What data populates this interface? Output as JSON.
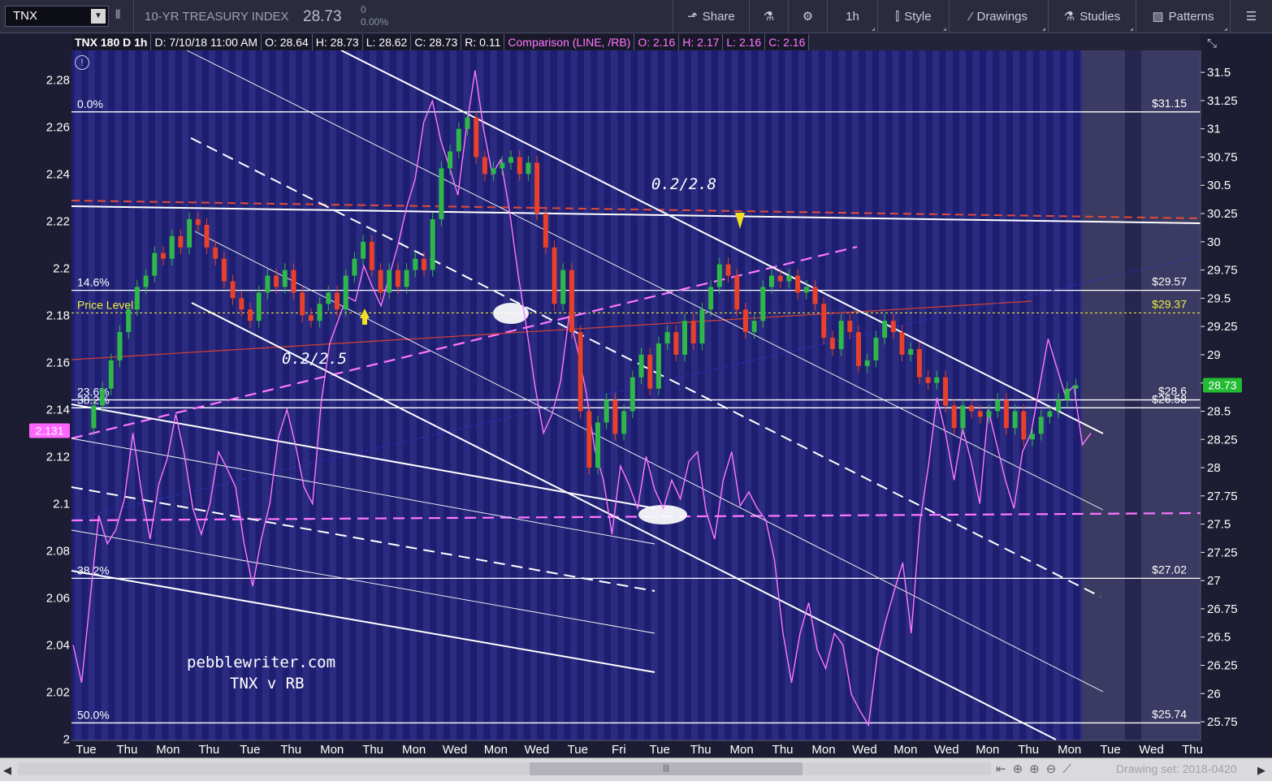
{
  "toolbar": {
    "symbol": "TNX",
    "description": "10-YR TREASURY INDEX",
    "last": "28.73",
    "change_abs": "0",
    "change_pct": "0.00%",
    "share": "Share",
    "interval": "1h",
    "style": "Style",
    "drawings": "Drawings",
    "studies": "Studies",
    "patterns": "Patterns"
  },
  "infobar": {
    "main": "TNX 180 D 1h",
    "date": "D: 7/10/18 11:00 AM",
    "open": "O: 28.64",
    "high": "H: 28.73",
    "low": "L: 28.62",
    "close": "C: 28.73",
    "range": "R: 0.11",
    "comparison": "Comparison (LINE, /RB)",
    "cmp_open": "O: 2.16",
    "cmp_high": "H: 2.17",
    "cmp_low": "L: 2.16",
    "cmp_close": "C: 2.16"
  },
  "bottombar": {
    "drawing_set": "Drawing set: 2018-0420"
  },
  "chart_data": {
    "type": "line",
    "title": "",
    "left_axis": {
      "ticks": [
        "2.28",
        "2.26",
        "2.24",
        "2.22",
        "2.2",
        "2.18",
        "2.16",
        "2.14",
        "2.12",
        "2.1",
        "2.08",
        "2.06",
        "2.04",
        "2.02",
        "2"
      ],
      "range": [
        1.9995,
        2.2925
      ],
      "current_label": "2.131"
    },
    "right_axis": {
      "ticks": [
        "31.5",
        "31.25",
        "31",
        "30.75",
        "30.5",
        "30.25",
        "30",
        "29.75",
        "29.5",
        "29.25",
        "29",
        "28.75",
        "28.5",
        "28.25",
        "28",
        "27.75",
        "27.5",
        "27.25",
        "27",
        "26.75",
        "26.5",
        "26.25",
        "26",
        "25.75"
      ],
      "range": [
        25.585,
        31.695
      ],
      "current_label": "28.73"
    },
    "x_ticks": [
      "Tue",
      "Thu",
      "Mon",
      "Thu",
      "Tue",
      "Thu",
      "Mon",
      "Thu",
      "Mon",
      "Wed",
      "Mon",
      "Wed",
      "Tue",
      "Fri",
      "Tue",
      "Thu",
      "Mon",
      "Thu",
      "Mon",
      "Wed",
      "Mon",
      "Wed",
      "Mon",
      "Thu",
      "Mon",
      "Tue",
      "Wed",
      "Thu"
    ],
    "fib_levels": [
      {
        "label": "0.0%",
        "value": "$31.15",
        "y": 31.15
      },
      {
        "label": "14.6%",
        "value": "$29.57",
        "y": 29.57
      },
      {
        "label": "23.6%",
        "value": "$28.6",
        "y": 28.6
      },
      {
        "label": "38.2%",
        "value": "$26.58",
        "y": 28.53
      },
      {
        "label": "38.2%",
        "value": "$27.02",
        "y": 27.02
      },
      {
        "label": "50.0%",
        "value": "$25.74",
        "y": 25.74
      }
    ],
    "price_level": {
      "label": "Price Level1",
      "value": "$29.37",
      "y": 29.37
    },
    "annotations": [
      "0.2/2.8",
      "0.2/2.5",
      "pebblewriter.com",
      "TNX v RB"
    ],
    "series": [
      {
        "name": "TNX",
        "style": "candles",
        "color_up": "#2fb84a",
        "color_down": "#e8402a",
        "points": [
          [
            0,
            28.35
          ],
          [
            2,
            28.55
          ],
          [
            3,
            28.7
          ],
          [
            4,
            28.95
          ],
          [
            5,
            29.2
          ],
          [
            6,
            29.4
          ],
          [
            7,
            29.6
          ],
          [
            8,
            29.7
          ],
          [
            9,
            29.9
          ],
          [
            10,
            29.85
          ],
          [
            11,
            30.05
          ],
          [
            12,
            29.95
          ],
          [
            13,
            30.2
          ],
          [
            14,
            30.15
          ],
          [
            15,
            29.95
          ],
          [
            16,
            29.85
          ],
          [
            17,
            29.65
          ],
          [
            18,
            29.5
          ],
          [
            19,
            29.4
          ],
          [
            20,
            29.3
          ],
          [
            21,
            29.55
          ],
          [
            22,
            29.7
          ],
          [
            23,
            29.6
          ],
          [
            24,
            29.75
          ],
          [
            25,
            29.55
          ],
          [
            26,
            29.35
          ],
          [
            27,
            29.3
          ],
          [
            28,
            29.45
          ],
          [
            29,
            29.55
          ],
          [
            30,
            29.4
          ],
          [
            31,
            29.7
          ],
          [
            32,
            29.85
          ],
          [
            33,
            30.0
          ],
          [
            34,
            29.75
          ],
          [
            35,
            29.55
          ],
          [
            36,
            29.75
          ],
          [
            37,
            29.6
          ],
          [
            38,
            29.75
          ],
          [
            39,
            29.85
          ],
          [
            40,
            29.75
          ],
          [
            41,
            30.2
          ],
          [
            42,
            30.65
          ],
          [
            43,
            30.8
          ],
          [
            44,
            31.0
          ],
          [
            45,
            31.1
          ],
          [
            46,
            30.75
          ],
          [
            47,
            30.6
          ],
          [
            48,
            30.65
          ],
          [
            49,
            30.7
          ],
          [
            50,
            30.75
          ],
          [
            51,
            30.6
          ],
          [
            52,
            30.7
          ],
          [
            53,
            30.25
          ],
          [
            54,
            29.95
          ],
          [
            55,
            29.45
          ],
          [
            56,
            29.75
          ],
          [
            57,
            29.2
          ],
          [
            58,
            28.5
          ],
          [
            59,
            28.0
          ],
          [
            60,
            28.4
          ],
          [
            61,
            28.6
          ],
          [
            62,
            28.3
          ],
          [
            63,
            28.5
          ],
          [
            64,
            28.8
          ],
          [
            65,
            29.0
          ],
          [
            66,
            28.7
          ],
          [
            67,
            29.1
          ],
          [
            68,
            29.2
          ],
          [
            69,
            29.0
          ],
          [
            70,
            29.3
          ],
          [
            71,
            29.1
          ],
          [
            72,
            29.4
          ],
          [
            73,
            29.6
          ],
          [
            74,
            29.8
          ],
          [
            75,
            29.7
          ],
          [
            76,
            29.4
          ],
          [
            77,
            29.2
          ],
          [
            78,
            29.3
          ],
          [
            79,
            29.6
          ],
          [
            80,
            29.7
          ],
          [
            81,
            29.65
          ],
          [
            82,
            29.7
          ],
          [
            83,
            29.55
          ],
          [
            84,
            29.6
          ],
          [
            85,
            29.45
          ],
          [
            86,
            29.15
          ],
          [
            87,
            29.05
          ],
          [
            88,
            29.3
          ],
          [
            89,
            29.2
          ],
          [
            90,
            28.9
          ],
          [
            91,
            28.95
          ],
          [
            92,
            29.15
          ],
          [
            93,
            29.3
          ],
          [
            94,
            29.2
          ],
          [
            95,
            29.0
          ],
          [
            96,
            29.05
          ],
          [
            97,
            28.8
          ],
          [
            98,
            28.75
          ],
          [
            99,
            28.8
          ],
          [
            100,
            28.55
          ],
          [
            101,
            28.35
          ],
          [
            102,
            28.55
          ],
          [
            103,
            28.5
          ],
          [
            104,
            28.45
          ],
          [
            105,
            28.5
          ],
          [
            106,
            28.6
          ],
          [
            107,
            28.35
          ],
          [
            108,
            28.5
          ],
          [
            109,
            28.25
          ],
          [
            110,
            28.3
          ],
          [
            111,
            28.45
          ],
          [
            112,
            28.5
          ],
          [
            113,
            28.6
          ],
          [
            114,
            28.7
          ],
          [
            115,
            28.73
          ]
        ]
      },
      {
        "name": "/RB",
        "style": "line",
        "color": "#ff77ff",
        "points": [
          [
            0,
            2.04
          ],
          [
            1,
            2.024
          ],
          [
            2,
            2.06
          ],
          [
            3,
            2.095
          ],
          [
            4,
            2.083
          ],
          [
            5,
            2.089
          ],
          [
            6,
            2.102
          ],
          [
            7,
            2.13
          ],
          [
            8,
            2.105
          ],
          [
            9,
            2.085
          ],
          [
            10,
            2.108
          ],
          [
            11,
            2.119
          ],
          [
            12,
            2.138
          ],
          [
            13,
            2.121
          ],
          [
            14,
            2.098
          ],
          [
            15,
            2.087
          ],
          [
            16,
            2.1
          ],
          [
            17,
            2.122
          ],
          [
            18,
            2.115
          ],
          [
            19,
            2.107
          ],
          [
            20,
            2.083
          ],
          [
            21,
            2.065
          ],
          [
            22,
            2.085
          ],
          [
            23,
            2.1
          ],
          [
            24,
            2.128
          ],
          [
            25,
            2.14
          ],
          [
            26,
            2.125
          ],
          [
            27,
            2.107
          ],
          [
            28,
            2.1
          ],
          [
            29,
            2.143
          ],
          [
            30,
            2.168
          ],
          [
            31,
            2.178
          ],
          [
            32,
            2.188
          ],
          [
            33,
            2.186
          ],
          [
            34,
            2.201
          ],
          [
            35,
            2.192
          ],
          [
            36,
            2.184
          ],
          [
            37,
            2.197
          ],
          [
            38,
            2.21
          ],
          [
            39,
            2.226
          ],
          [
            40,
            2.238
          ],
          [
            41,
            2.262
          ],
          [
            42,
            2.271
          ],
          [
            43,
            2.254
          ],
          [
            44,
            2.243
          ],
          [
            45,
            2.231
          ],
          [
            46,
            2.26
          ],
          [
            47,
            2.284
          ],
          [
            48,
            2.259
          ],
          [
            49,
            2.24
          ],
          [
            50,
            2.246
          ],
          [
            51,
            2.225
          ],
          [
            52,
            2.198
          ],
          [
            53,
            2.175
          ],
          [
            54,
            2.15
          ],
          [
            55,
            2.13
          ],
          [
            56,
            2.138
          ],
          [
            57,
            2.152
          ],
          [
            58,
            2.18
          ],
          [
            59,
            2.165
          ],
          [
            60,
            2.147
          ],
          [
            61,
            2.123
          ],
          [
            62,
            2.11
          ],
          [
            63,
            2.087
          ],
          [
            64,
            2.116
          ],
          [
            65,
            2.108
          ],
          [
            66,
            2.098
          ],
          [
            67,
            2.12
          ],
          [
            68,
            2.106
          ],
          [
            69,
            2.098
          ],
          [
            70,
            2.11
          ],
          [
            71,
            2.102
          ],
          [
            72,
            2.118
          ],
          [
            73,
            2.122
          ],
          [
            74,
            2.097
          ],
          [
            75,
            2.085
          ],
          [
            76,
            2.11
          ],
          [
            77,
            2.122
          ],
          [
            78,
            2.099
          ],
          [
            79,
            2.105
          ],
          [
            80,
            2.098
          ],
          [
            81,
            2.093
          ],
          [
            82,
            2.076
          ],
          [
            83,
            2.045
          ],
          [
            84,
            2.024
          ],
          [
            85,
            2.045
          ],
          [
            86,
            2.058
          ],
          [
            87,
            2.038
          ],
          [
            88,
            2.03
          ],
          [
            89,
            2.045
          ],
          [
            90,
            2.04
          ],
          [
            91,
            2.019
          ],
          [
            92,
            2.012
          ],
          [
            93,
            2.006
          ],
          [
            94,
            2.035
          ],
          [
            95,
            2.05
          ],
          [
            96,
            2.063
          ],
          [
            97,
            2.075
          ],
          [
            98,
            2.045
          ],
          [
            99,
            2.092
          ],
          [
            100,
            2.116
          ],
          [
            101,
            2.145
          ],
          [
            102,
            2.13
          ],
          [
            103,
            2.11
          ],
          [
            104,
            2.132
          ],
          [
            105,
            2.118
          ],
          [
            106,
            2.1
          ],
          [
            107,
            2.14
          ],
          [
            108,
            2.125
          ],
          [
            109,
            2.11
          ],
          [
            110,
            2.098
          ],
          [
            111,
            2.122
          ],
          [
            112,
            2.13
          ],
          [
            113,
            2.15
          ],
          [
            114,
            2.17
          ],
          [
            115,
            2.158
          ],
          [
            116,
            2.146
          ],
          [
            117,
            2.15
          ],
          [
            118,
            2.125
          ],
          [
            119,
            2.13
          ]
        ]
      }
    ]
  }
}
